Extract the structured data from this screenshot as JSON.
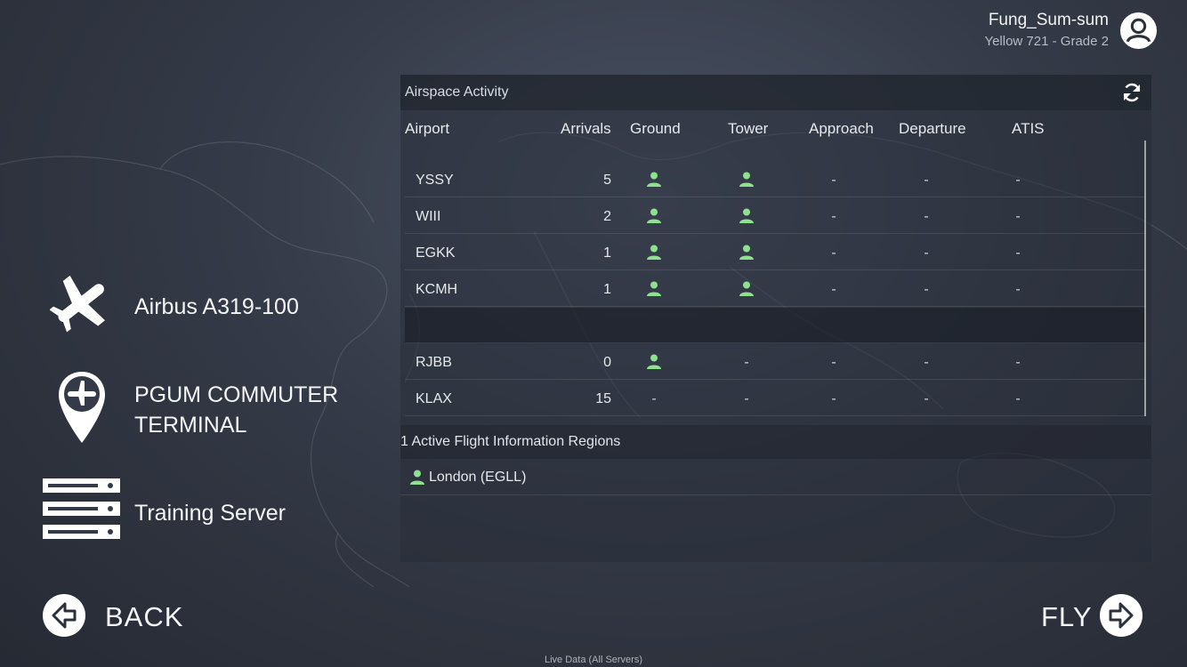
{
  "user": {
    "name": "Fung_Sum-sum",
    "grade": "Yellow 721 - Grade 2",
    "avatar_icon": "user-circle-icon"
  },
  "flight": {
    "aircraft": {
      "icon": "airplane-icon",
      "label": "Airbus A319-100"
    },
    "location": {
      "icon": "map-pin-airplane-icon",
      "line1": "PGUM COMMUTER",
      "line2": "TERMINAL"
    },
    "server": {
      "icon": "server-icon",
      "label": "Training Server"
    }
  },
  "airspace": {
    "title": "Airspace Activity",
    "refresh_icon": "refresh-icon",
    "columns": {
      "airport": "Airport",
      "arrivals": "Arrivals",
      "ground": "Ground",
      "tower": "Tower",
      "approach": "Approach",
      "departure": "Departure",
      "atis": "ATIS"
    },
    "rows": [
      {
        "airport": "YSSY",
        "arrivals": "5",
        "ground": "person",
        "tower": "person",
        "approach": "-",
        "departure": "-",
        "atis": "-"
      },
      {
        "airport": "WIII",
        "arrivals": "2",
        "ground": "person",
        "tower": "person",
        "approach": "-",
        "departure": "-",
        "atis": "-"
      },
      {
        "airport": "EGKK",
        "arrivals": "1",
        "ground": "person",
        "tower": "person",
        "approach": "-",
        "departure": "-",
        "atis": "-"
      },
      {
        "airport": "KCMH",
        "arrivals": "1",
        "ground": "person",
        "tower": "person",
        "approach": "-",
        "departure": "-",
        "atis": "-"
      },
      {
        "airport": "",
        "arrivals": "",
        "ground": "",
        "tower": "",
        "approach": "",
        "departure": "",
        "atis": ""
      },
      {
        "airport": "RJBB",
        "arrivals": "0",
        "ground": "person",
        "tower": "-",
        "approach": "-",
        "departure": "-",
        "atis": "-"
      },
      {
        "airport": "KLAX",
        "arrivals": "15",
        "ground": "-",
        "tower": "-",
        "approach": "-",
        "departure": "-",
        "atis": "-"
      }
    ],
    "fir": {
      "title": "1 Active Flight Information Regions",
      "items": [
        {
          "label": "London (EGLL)"
        }
      ]
    }
  },
  "nav": {
    "back_label": "BACK",
    "fly_label": "FLY",
    "back_icon": "arrow-left-circle-icon",
    "fly_icon": "arrow-right-circle-icon"
  },
  "footer": "Live Data (All Servers)",
  "colors": {
    "controller_green": "#8fe08f",
    "background_dark": "#2b303b",
    "text_light": "#e6e8ec"
  }
}
